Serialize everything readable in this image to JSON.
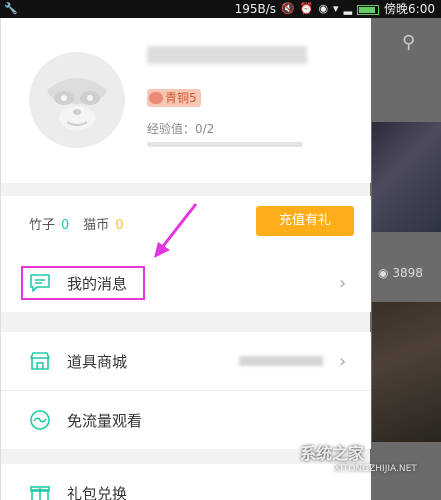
{
  "statusbar": {
    "speed": "195B/s",
    "time": "傍晚6:00"
  },
  "background": {
    "views": "3898",
    "watermark_main": "系统之家",
    "watermark_sub": "XITONGZHIJIA.NET"
  },
  "profile": {
    "level_label": "青铜5",
    "exp_text": "经验值：0/2",
    "exp_progress": 0
  },
  "wallet": {
    "bamboo_label": "竹子",
    "bamboo_value": "0",
    "coin_label": "猫币",
    "coin_value": "0",
    "recharge_label": "充值有礼"
  },
  "menu": {
    "messages_label": "我的消息",
    "shop_label": "道具商城",
    "free_label": "免流量观看",
    "gift_label": "礼包兑换"
  },
  "colors": {
    "accent_green": "#22c9a8",
    "accent_orange": "#ffad18",
    "highlight_magenta": "#e436e0"
  }
}
